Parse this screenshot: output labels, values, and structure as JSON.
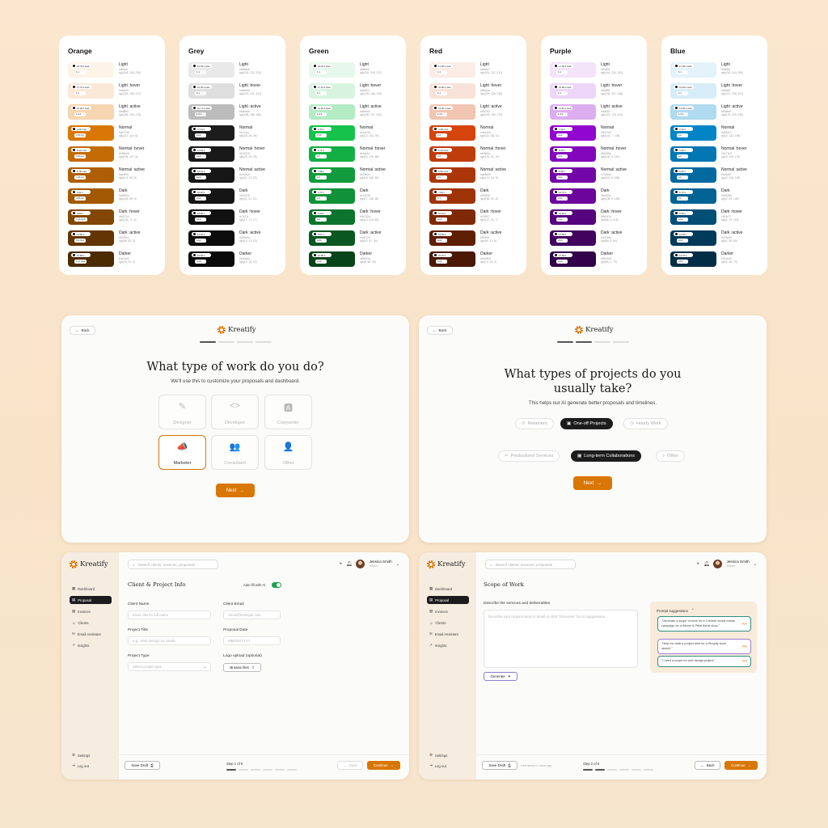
{
  "palettes": [
    {
      "name": "Orange",
      "swatches": [
        {
          "label": "Light",
          "hex": "#fef4e6",
          "rgb": "rgb(254, 244, 230)",
          "c": "#fdf3e7",
          "contrast": "18.79:1 AAA",
          "wcag": "1:1",
          "dark": false
        },
        {
          "label": "Light :hover",
          "hex": "#fdeed9",
          "rgb": "rgb(253, 238, 217)",
          "c": "#fbe9d8",
          "contrast": "17.70:1 AAA",
          "wcag": "1:1",
          "dark": false
        },
        {
          "label": "Light :active",
          "hex": "#fad8b0",
          "rgb": "rgb(250, 216, 176)",
          "c": "#f6d6b0",
          "contrast": "15.05:1 AAA",
          "wcag": "1.2:1",
          "dark": false
        },
        {
          "label": "Normal",
          "hex": "#d97706",
          "rgb": "rgb(217, 119, 6)",
          "c": "#d97706",
          "contrast": "4.22:1 AA",
          "wcag": "3.00 AA",
          "dark": true
        },
        {
          "label": "Normal :hover",
          "hex": "#c36b05",
          "rgb": "rgb(195, 107, 5)",
          "c": "#c36b05",
          "contrast": "5.04:1 AA",
          "wcag": "3.60 AA",
          "dark": true
        },
        {
          "label": "Normal :active",
          "hex": "#ae5f05",
          "rgb": "rgb(174, 95, 5)",
          "c": "#ae5f05",
          "contrast": "6.18:1 AA",
          "wcag": "4.36 AA",
          "dark": true
        },
        {
          "label": "Dark",
          "hex": "#a35904",
          "rgb": "rgb(163, 89, 4)",
          "c": "#a35904",
          "contrast": "6.91:1",
          "wcag": "4.88 AA",
          "dark": true
        },
        {
          "label": "Dark :hover",
          "hex": "#824704",
          "rgb": "rgb(130, 71, 4)",
          "c": "#824704",
          "contrast": "9.86:1",
          "wcag": "7.00 AAA",
          "dark": true
        },
        {
          "label": "Dark :active",
          "hex": "#623503",
          "rgb": "rgb(98, 53, 3)",
          "c": "#623503",
          "contrast": "13.60:1",
          "wcag": "9.6 AAA",
          "dark": true
        },
        {
          "label": "Darker",
          "hex": "#4c2a02",
          "rgb": "rgb(76, 42, 2)",
          "c": "#4c2a02",
          "contrast": "15.80:1",
          "wcag": "11.2 AAA",
          "dark": true
        }
      ]
    },
    {
      "name": "Grey",
      "swatches": [
        {
          "label": "Light",
          "hex": "#e8e8e8",
          "rgb": "rgb(232, 232, 232)",
          "c": "#e9e9e9",
          "contrast": "16.45:1 AAA",
          "wcag": "1:1",
          "dark": false
        },
        {
          "label": "Light :hover",
          "hex": "#dddddd",
          "rgb": "rgb(221, 221, 221)",
          "c": "#dedede",
          "contrast": "15.05:1 AAA",
          "wcag": "1:1",
          "dark": false
        },
        {
          "label": "Light :active",
          "hex": "#bababa",
          "rgb": "rgb(186, 186, 186)",
          "c": "#bbbbbb",
          "contrast": "10.71:1 AAA",
          "wcag": "1.5:1",
          "dark": false
        },
        {
          "label": "Normal",
          "hex": "#1c1c1c",
          "rgb": "rgb(28, 28, 28)",
          "c": "#1c1c1c",
          "contrast": "17.10:1",
          "wcag": "AAA",
          "dark": true
        },
        {
          "label": "Normal :hover",
          "hex": "#191919",
          "rgb": "rgb(25, 25, 25)",
          "c": "#191919",
          "contrast": "17.60:1",
          "wcag": "AAA",
          "dark": true
        },
        {
          "label": "Normal :active",
          "hex": "#161616",
          "rgb": "rgb(22, 22, 22)",
          "c": "#161616",
          "contrast": "18.10:1",
          "wcag": "AAA",
          "dark": true
        },
        {
          "label": "Dark",
          "hex": "#151515",
          "rgb": "rgb(21, 21, 21)",
          "c": "#151515",
          "contrast": "18.30:1",
          "wcag": "AAA",
          "dark": true
        },
        {
          "label": "Dark :hover",
          "hex": "#111111",
          "rgb": "rgb(17, 17, 17)",
          "c": "#111111",
          "contrast": "18.90:1",
          "wcag": "AAA",
          "dark": true
        },
        {
          "label": "Dark :active",
          "hex": "#0d0d0d",
          "rgb": "rgb(13, 13, 13)",
          "c": "#0d0d0d",
          "contrast": "19.40:1",
          "wcag": "AAA",
          "dark": true
        },
        {
          "label": "Darker",
          "hex": "#0a0a0a",
          "rgb": "rgb(10, 10, 10)",
          "c": "#0a0a0a",
          "contrast": "19.80:1",
          "wcag": "AAA",
          "dark": true
        }
      ]
    },
    {
      "name": "Green",
      "swatches": [
        {
          "label": "Light",
          "hex": "#e8f9ed",
          "rgb": "rgb(232, 249, 237)",
          "c": "#e6f7eb",
          "contrast": "18.20:1 AAA",
          "wcag": "1:1",
          "dark": false
        },
        {
          "label": "Light :hover",
          "hex": "#dcf6e4",
          "rgb": "rgb(220, 246, 228)",
          "c": "#d8f4e0",
          "contrast": "17.10:1 AAA",
          "wcag": "1:1",
          "dark": false
        },
        {
          "label": "Light :active",
          "hex": "#b6edc8",
          "rgb": "rgb(182, 237, 200)",
          "c": "#b3ebc5",
          "contrast": "14.20:1 AAA",
          "wcag": "1.2:1",
          "dark": false
        },
        {
          "label": "Normal",
          "hex": "#16c24b",
          "rgb": "rgb(22, 194, 75)",
          "c": "#16c24b",
          "contrast": "2.30:1",
          "wcag": "3.00",
          "dark": true
        },
        {
          "label": "Normal :hover",
          "hex": "#14af44",
          "rgb": "rgb(20, 175, 68)",
          "c": "#14af44",
          "contrast": "2.71:1",
          "wcag": "3.5",
          "dark": true
        },
        {
          "label": "Normal :active",
          "hex": "#129b3c",
          "rgb": "rgb(18, 155, 60)",
          "c": "#129b3c",
          "contrast": "3.38:1",
          "wcag": "4.0",
          "dark": true
        },
        {
          "label": "Dark",
          "hex": "#119238",
          "rgb": "rgb(17, 146, 56)",
          "c": "#119238",
          "contrast": "3.77:1",
          "wcag": "4.5",
          "dark": true
        },
        {
          "label": "Dark :hover",
          "hex": "#0d742d",
          "rgb": "rgb(13, 116, 45)",
          "c": "#0d742d",
          "contrast": "5.23:1",
          "wcag": "AA",
          "dark": true
        },
        {
          "label": "Dark :active",
          "hex": "#0a5722",
          "rgb": "rgb(10, 87, 34)",
          "c": "#0a5722",
          "contrast": "8.07:1",
          "wcag": "AAA",
          "dark": true
        },
        {
          "label": "Darker",
          "hex": "#08441a",
          "rgb": "rgb(8, 68, 26)",
          "c": "#08441a",
          "contrast": "10.80:1",
          "wcag": "AAA",
          "dark": true
        }
      ]
    },
    {
      "name": "Red",
      "swatches": [
        {
          "label": "Light",
          "hex": "#fbede7",
          "rgb": "rgb(251, 237, 231)",
          "c": "#fbece6",
          "contrast": "17.90:1 AAA",
          "wcag": "1:1",
          "dark": false
        },
        {
          "label": "Light :hover",
          "hex": "#f9e4da",
          "rgb": "rgb(249, 228, 218)",
          "c": "#f8e2d8",
          "contrast": "16.80:1 AAA",
          "wcag": "1:1",
          "dark": false
        },
        {
          "label": "Light :active",
          "hex": "#f3c7b3",
          "rgb": "rgb(243, 199, 179)",
          "c": "#f1c5b1",
          "contrast": "13.30:1 AAA",
          "wcag": "1.3:1",
          "dark": false
        },
        {
          "label": "Normal",
          "hex": "#d4440b",
          "rgb": "rgb(212, 68, 11)",
          "c": "#d4440b",
          "contrast": "4.48:1 AA",
          "wcag": "3.2",
          "dark": true
        },
        {
          "label": "Normal :hover",
          "hex": "#bf3d0a",
          "rgb": "rgb(191, 61, 10)",
          "c": "#bf3d0a",
          "contrast": "5.40:1 AA",
          "wcag": "3.8",
          "dark": true
        },
        {
          "label": "Normal :active",
          "hex": "#aa3609",
          "rgb": "rgb(170, 54, 9)",
          "c": "#aa3609",
          "contrast": "6.55:1 AA",
          "wcag": "4.6",
          "dark": true
        },
        {
          "label": "Dark",
          "hex": "#9f3308",
          "rgb": "rgb(159, 51, 8)",
          "c": "#9f3308",
          "contrast": "7.30:1",
          "wcag": "5.1",
          "dark": true
        },
        {
          "label": "Dark :hover",
          "hex": "#7f2907",
          "rgb": "rgb(127, 41, 7)",
          "c": "#7f2907",
          "contrast": "10.10:1",
          "wcag": "AAA",
          "dark": true
        },
        {
          "label": "Dark :active",
          "hex": "#5f1f05",
          "rgb": "rgb(95, 31, 5)",
          "c": "#5f1f05",
          "contrast": "13.50:1",
          "wcag": "AAA",
          "dark": true
        },
        {
          "label": "Darker",
          "hex": "#4a1804",
          "rgb": "rgb(74, 24, 4)",
          "c": "#4a1804",
          "contrast": "15.70:1",
          "wcag": "AAA",
          "dark": true
        }
      ]
    },
    {
      "name": "Purple",
      "swatches": [
        {
          "label": "Light",
          "hex": "#f4e6fb",
          "rgb": "rgb(244, 230, 251)",
          "c": "#f3e4fa",
          "contrast": "17.00:1 AAA",
          "wcag": "1:1",
          "dark": false
        },
        {
          "label": "Light :hover",
          "hex": "#efd9f8",
          "rgb": "rgb(239, 217, 248)",
          "c": "#edd6f7",
          "contrast": "15.80:1 AAA",
          "wcag": "1:1",
          "dark": false
        },
        {
          "label": "Light :active",
          "hex": "#ddb0f1",
          "rgb": "rgb(221, 176, 241)",
          "c": "#dcaef0",
          "contrast": "11.90:1 AAA",
          "wcag": "1.4:1",
          "dark": false
        },
        {
          "label": "Normal",
          "hex": "#9007d0",
          "rgb": "rgb(144, 7, 208)",
          "c": "#9007d0",
          "contrast": "7.20:1",
          "wcag": "AAA",
          "dark": true
        },
        {
          "label": "Normal :hover",
          "hex": "#8206bb",
          "rgb": "rgb(130, 6, 187)",
          "c": "#8206bb",
          "contrast": "8.40:1",
          "wcag": "AAA",
          "dark": true
        },
        {
          "label": "Normal :active",
          "hex": "#7306a6",
          "rgb": "rgb(115, 6, 166)",
          "c": "#7306a6",
          "contrast": "9.90:1",
          "wcag": "AAA",
          "dark": true
        },
        {
          "label": "Dark",
          "hex": "#6c059c",
          "rgb": "rgb(108, 5, 156)",
          "c": "#6c059c",
          "contrast": "10.70:1",
          "wcag": "AAA",
          "dark": true
        },
        {
          "label": "Dark :hover",
          "hex": "#56047d",
          "rgb": "rgb(86, 4, 125)",
          "c": "#56047d",
          "contrast": "13.20:1",
          "wcag": "AAA",
          "dark": true
        },
        {
          "label": "Dark :active",
          "hex": "#41035e",
          "rgb": "rgb(65, 3, 94)",
          "c": "#41035e",
          "contrast": "15.90:1",
          "wcag": "AAA",
          "dark": true
        },
        {
          "label": "Darker",
          "hex": "#320249",
          "rgb": "rgb(50, 2, 73)",
          "c": "#320249",
          "contrast": "17.50:1",
          "wcag": "AAA",
          "dark": true
        }
      ]
    },
    {
      "name": "Blue",
      "swatches": [
        {
          "label": "Light",
          "hex": "#e6f4fa",
          "rgb": "rgb(230, 244, 250)",
          "c": "#e4f3fa",
          "contrast": "17.90:1 AAA",
          "wcag": "1:1",
          "dark": false
        },
        {
          "label": "Light :hover",
          "hex": "#d9eef7",
          "rgb": "rgb(217, 238, 247)",
          "c": "#d7edf7",
          "contrast": "16.90:1 AAA",
          "wcag": "1:1",
          "dark": false
        },
        {
          "label": "Light :active",
          "hex": "#b0dbef",
          "rgb": "rgb(176, 219, 239)",
          "c": "#afdaef",
          "contrast": "14.00:1 AAA",
          "wcag": "1.2:1",
          "dark": false
        },
        {
          "label": "Normal",
          "hex": "#0284c7",
          "rgb": "rgb(2, 132, 199)",
          "c": "#0284c7",
          "contrast": "4.10:1",
          "wcag": "AA",
          "dark": true
        },
        {
          "label": "Normal :hover",
          "hex": "#0277b3",
          "rgb": "rgb(2, 119, 179)",
          "c": "#0277b3",
          "contrast": "4.90:1",
          "wcag": "AA",
          "dark": true
        },
        {
          "label": "Normal :active",
          "hex": "#026a9f",
          "rgb": "rgb(2, 106, 159)",
          "c": "#026a9f",
          "contrast": "6.00:1",
          "wcag": "AA",
          "dark": true
        },
        {
          "label": "Dark",
          "hex": "#026395",
          "rgb": "rgb(2, 99, 149)",
          "c": "#026395",
          "contrast": "6.70:1",
          "wcag": "AA",
          "dark": true
        },
        {
          "label": "Dark :hover",
          "hex": "#014f77",
          "rgb": "rgb(1, 79, 119)",
          "c": "#014f77",
          "contrast": "9.30:1",
          "wcag": "AAA",
          "dark": true
        },
        {
          "label": "Dark :active",
          "hex": "#013b59",
          "rgb": "rgb(1, 59, 89)",
          "c": "#013b59",
          "contrast": "12.50:1",
          "wcag": "AAA",
          "dark": true
        },
        {
          "label": "Darker",
          "hex": "#012e46",
          "rgb": "rgb(1, 46, 70)",
          "c": "#012e46",
          "contrast": "14.70:1",
          "wcag": "AAA",
          "dark": true
        }
      ]
    }
  ],
  "brand": {
    "name": "Kreatify",
    "accent": "#d97706"
  },
  "screen1": {
    "back": "Back",
    "title": "What type of work do you do?",
    "subtitle": "We'll use this to customize your proposals and dashboard.",
    "options": [
      {
        "label": "Designer",
        "icon": "brush-icon",
        "glyph": "✎"
      },
      {
        "label": "Developer",
        "icon": "code-icon",
        "glyph": "<>"
      },
      {
        "label": "Copywriter",
        "icon": "document-icon",
        "glyph": "🅰"
      },
      {
        "label": "Marketer",
        "icon": "megaphone-icon",
        "glyph": "📣"
      },
      {
        "label": "Consultant",
        "icon": "users-icon",
        "glyph": "👥"
      },
      {
        "label": "Other",
        "icon": "user-search-icon",
        "glyph": "👤"
      }
    ],
    "next": "Next"
  },
  "screen2": {
    "back": "Back",
    "title": "What types of projects do you usually take?",
    "subtitle": "This helps our AI generate better proposals and timelines.",
    "tags": [
      {
        "label": "Retainers",
        "selected": false
      },
      {
        "label": "One-off Projects",
        "selected": true
      },
      {
        "label": "Hourly Work",
        "selected": false
      },
      {
        "label": "Productized Services",
        "selected": false
      },
      {
        "label": "Long-term Collaborations",
        "selected": true
      },
      {
        "label": "Other",
        "selected": false
      }
    ],
    "next": "Next"
  },
  "app": {
    "search_placeholder": "Search clients, invoices, proposals",
    "user_name": "Jessica Smith",
    "user_role": "Admin",
    "nav": [
      "Dashboard",
      "Proposal",
      "Invoices",
      "Clients",
      "Email Assistant",
      "Insights"
    ],
    "nav_bottom": [
      "Settings",
      "Log out"
    ]
  },
  "screen3": {
    "section": "Client & Project Info",
    "ai_toggle": "Auto fill with AI",
    "client_name_label": "Client Name",
    "client_name_ph": "Enter client's full name",
    "client_email_label": "Client Email",
    "client_email_ph": "client@example.com",
    "project_title_label": "Project Title",
    "project_title_ph": "e.g., Web Design for Sarah",
    "proposal_date_label": "Proposal Date",
    "proposal_date_ph": "MM/DD/YYYY",
    "project_type_label": "Project Type",
    "project_type_ph": "Select project type",
    "logo_label": "Logo upload (optional)",
    "browse": "Browse files",
    "save_draft": "Save Draft",
    "step": "Step 1 of 6",
    "back": "Back",
    "continue": "Continue"
  },
  "screen4": {
    "section": "Scope of Work",
    "desc_label": "Describe the services and deliverables",
    "desc_ph": "Describe your requirements in detail or click \"Generate\" for AI suggestions.",
    "generate": "Generate",
    "prompt_title": "Prompt suggestions",
    "suggestions": [
      "\"Generate a scope of work for a 3-month social media campaign for a Bloom & Petal florist shop.\"",
      "\"Help me draft a project brief for a Shopify store launch.\"",
      "\"I need a scope for web design project\""
    ],
    "add": "Add",
    "save_draft": "Save Draft",
    "last_saved": "Last saved 2 mins ago",
    "step": "Step 2 of 6",
    "back": "Back",
    "continue": "Continue"
  }
}
